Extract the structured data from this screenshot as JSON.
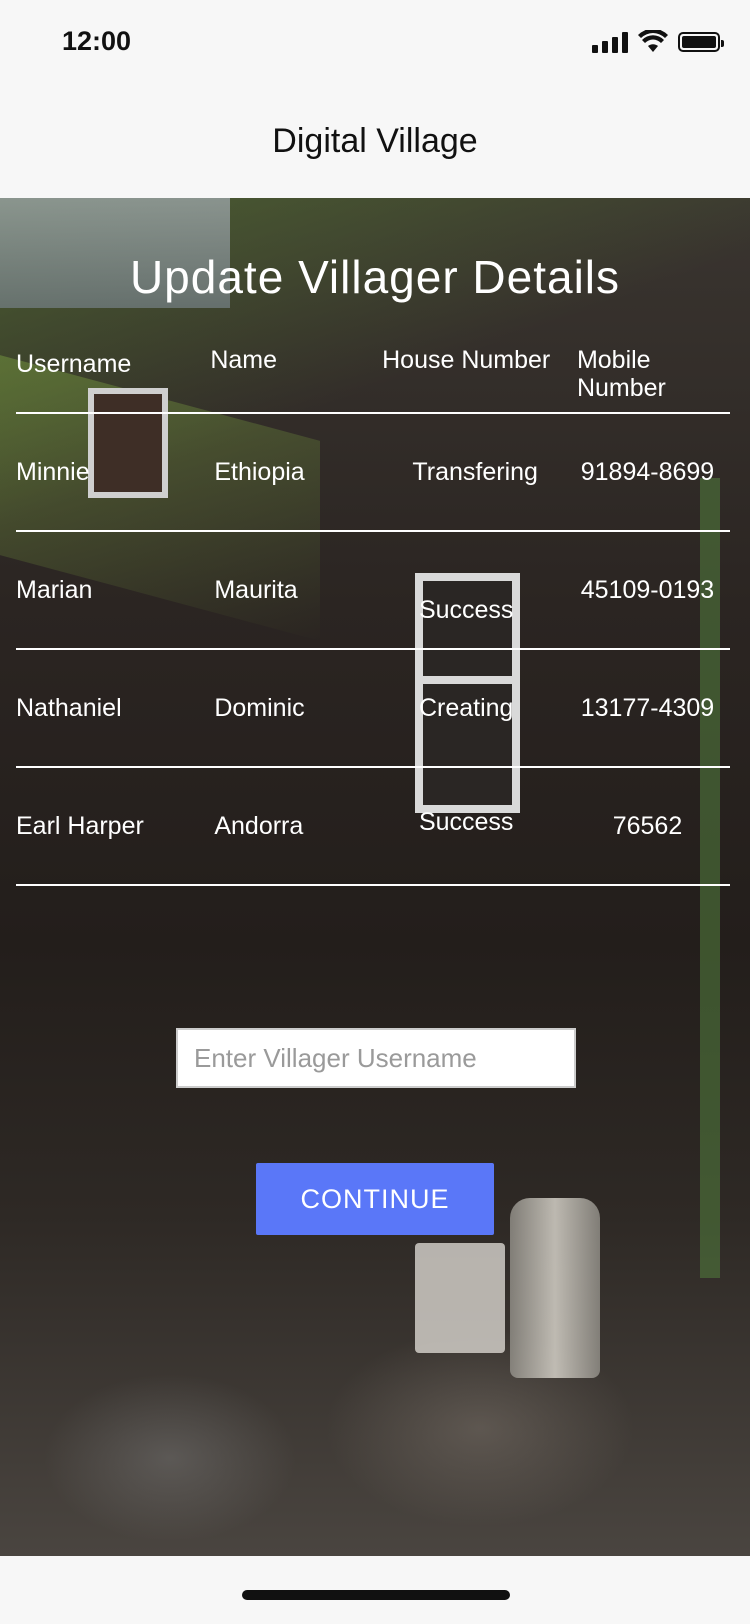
{
  "status_bar": {
    "time": "12:00"
  },
  "header": {
    "title": "Digital Village"
  },
  "main": {
    "title": "Update Villager Details",
    "table": {
      "columns": [
        "Username",
        "Name",
        "House Number",
        "Mobile Number"
      ],
      "rows": [
        [
          "Minnie",
          "Ethiopia",
          "Transfering",
          "91894-8699"
        ],
        [
          "Marian",
          "Maurita",
          "Success",
          "45109-0193"
        ],
        [
          "Nathaniel",
          "Dominic",
          "Creating",
          "13177-4309"
        ],
        [
          "Earl Harper",
          "Andorra",
          "Success",
          "76562"
        ]
      ]
    },
    "username_input": {
      "placeholder": "Enter Villager Username",
      "value": ""
    },
    "continue_label": "CONTINUE"
  },
  "colors": {
    "button": "#5a77f8",
    "text_on_image": "#ffffff"
  }
}
